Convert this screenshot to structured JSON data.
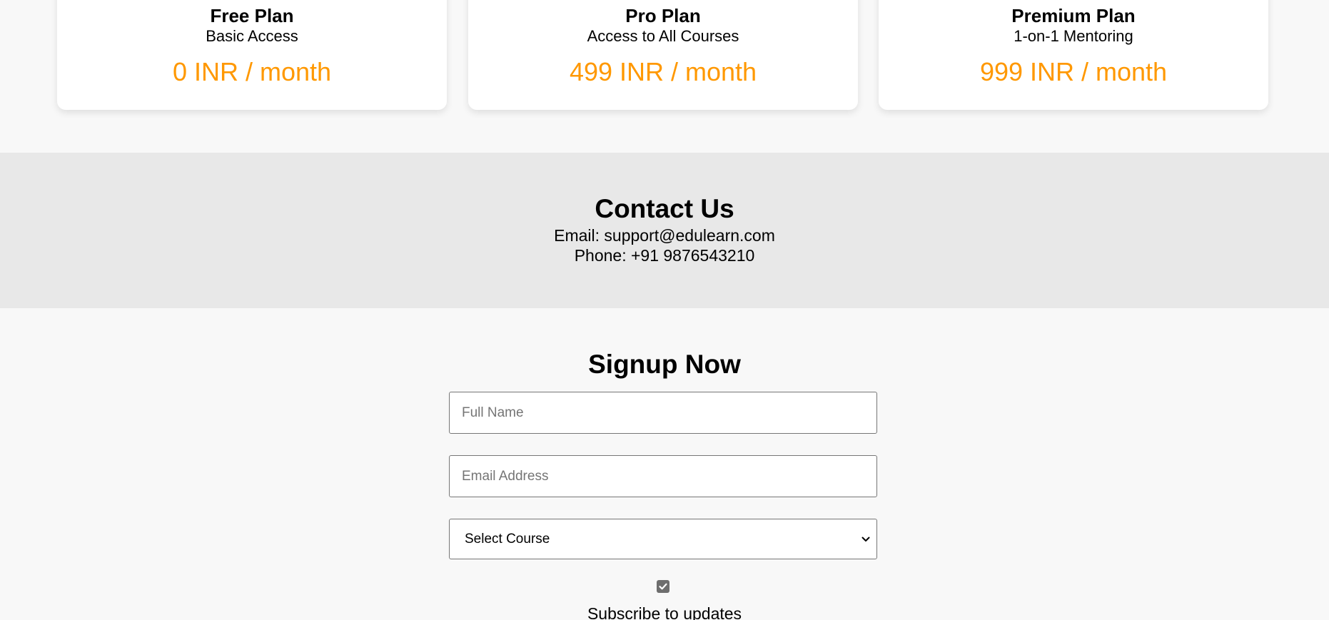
{
  "plans": [
    {
      "name": "Free Plan",
      "description": "Basic Access",
      "price": "0 INR / month"
    },
    {
      "name": "Pro Plan",
      "description": "Access to All Courses",
      "price": "499 INR / month"
    },
    {
      "name": "Premium Plan",
      "description": "1-on-1 Mentoring",
      "price": "999 INR / month"
    }
  ],
  "contact": {
    "title": "Contact Us",
    "email": "Email: support@edulearn.com",
    "phone": "Phone: +91 9876543210"
  },
  "signup": {
    "title": "Signup Now",
    "name_placeholder": "Full Name",
    "email_placeholder": "Email Address",
    "course_selected": "Select Course",
    "subscribe_checked": true,
    "subscribe_label": "Subscribe to updates"
  },
  "colors": {
    "price_accent": "#ff9800",
    "contact_background": "#e8e8e8",
    "page_background": "#f8f8f8"
  }
}
